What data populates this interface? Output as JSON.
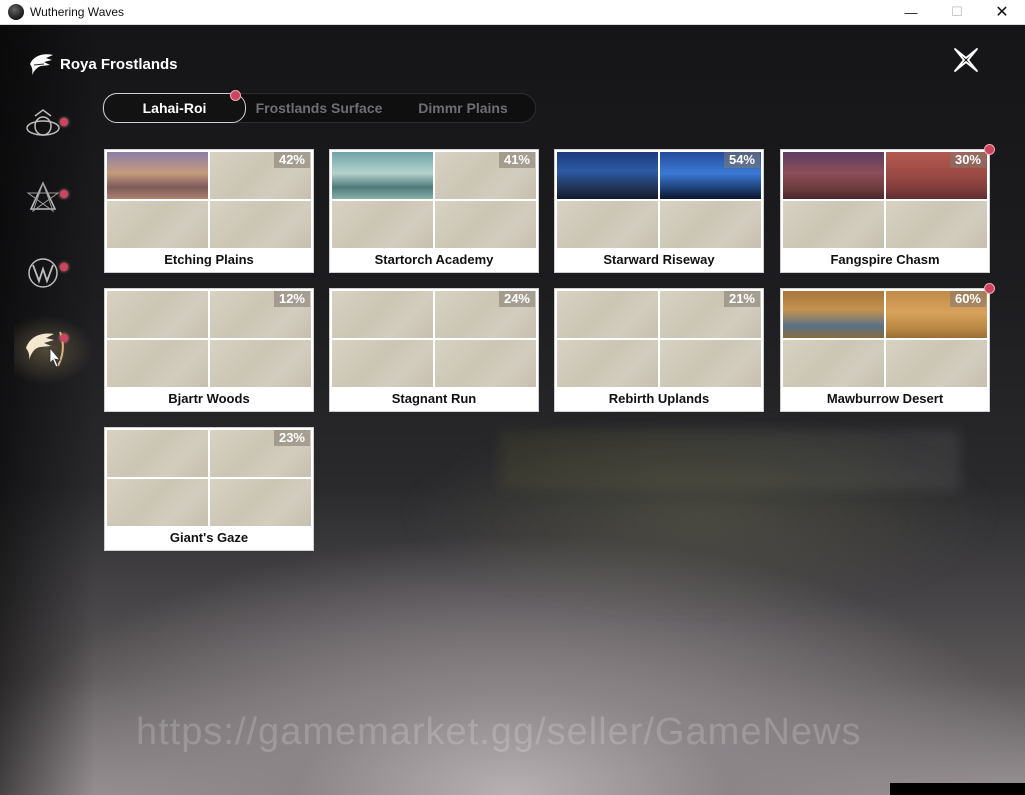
{
  "window": {
    "title": "Wuthering Waves",
    "controls": {
      "minimize": "—",
      "maximize": "☐",
      "close": "✕"
    }
  },
  "header": {
    "region_title": "Roya Frostlands",
    "region_icon": "region-emblem-icon",
    "close_icon": "close-x-icon"
  },
  "sidebar": {
    "items": [
      {
        "icon": "region-crest-1-icon",
        "has_notification": true,
        "active": false
      },
      {
        "icon": "region-crest-2-icon",
        "has_notification": true,
        "active": false
      },
      {
        "icon": "region-crest-3-icon",
        "has_notification": true,
        "active": false
      },
      {
        "icon": "region-crest-4-icon",
        "has_notification": true,
        "active": true
      }
    ]
  },
  "tabs": [
    {
      "label": "Lahai-Roi",
      "active": true
    },
    {
      "label": "Frostlands Surface",
      "active": false
    },
    {
      "label": "Dimmr Plains",
      "active": false
    }
  ],
  "areas": [
    {
      "name": "Etching Plains",
      "progress": "42%",
      "has_notification": false
    },
    {
      "name": "Startorch Academy",
      "progress": "41%",
      "has_notification": false
    },
    {
      "name": "Starward Riseway",
      "progress": "54%",
      "has_notification": false
    },
    {
      "name": "Fangspire Chasm",
      "progress": "30%",
      "has_notification": true
    },
    {
      "name": "Bjartr Woods",
      "progress": "12%",
      "has_notification": false
    },
    {
      "name": "Stagnant Run",
      "progress": "24%",
      "has_notification": false
    },
    {
      "name": "Rebirth Uplands",
      "progress": "21%",
      "has_notification": false
    },
    {
      "name": "Mawburrow Desert",
      "progress": "60%",
      "has_notification": true
    },
    {
      "name": "Giant's Gaze",
      "progress": "23%",
      "has_notification": false
    }
  ],
  "colors": {
    "notification": "#c9465e",
    "tab_active_text": "#ffffff",
    "tab_inactive_text": "#6f6f73"
  },
  "watermark": "https://gamemarket.gg/seller/GameNews"
}
